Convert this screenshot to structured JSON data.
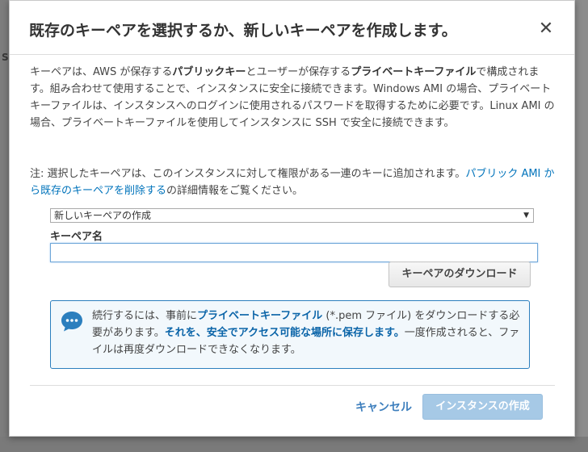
{
  "modal": {
    "title": "既存のキーペアを選択するか、新しいキーペアを作成します。",
    "close_symbol": "✕",
    "description": {
      "p1": "キーペアは、AWS が保存する",
      "b1": "パブリックキー",
      "p2": "とユーザーが保存する",
      "b2": "プライベートキーファイル",
      "p3": "で構成されます。組み合わせて使用することで、インスタンスに安全に接続できます。Windows AMI の場合、プライベートキーファイルは、インスタンスへのログインに使用されるパスワードを取得するために必要です。Linux AMI の場合、プライベートキーファイルを使用してインスタンスに SSH で安全に接続できます。"
    },
    "note": {
      "prefix": "注: 選択したキーペアは、このインスタンスに対して権限がある一連のキーに追加されます。",
      "link": "パブリック AMI から既存のキーペアを削除する",
      "suffix": "の詳細情報をご覧ください。"
    },
    "select": {
      "value": "新しいキーペアの作成"
    },
    "key_name": {
      "label": "キーペア名",
      "value": ""
    },
    "download_label": "キーペアのダウンロード",
    "info": {
      "t1": "続行するには、事前に",
      "b1": "プライベートキーファイル",
      "t2": " (*.pem ファイル) をダウンロードする必要があります。",
      "b2": "それを、安全でアクセス可能な場所に保存します。",
      "t3": "一度作成されると、ファイルは再度ダウンロードできなくなります。"
    },
    "cancel_label": "キャンセル",
    "launch_label": "インスタンスの作成"
  },
  "colors": {
    "link": "#0073bb",
    "info_border": "#2c7fbe",
    "launch_disabled": "#a6c9e6"
  },
  "icons": {
    "info": "chat-bubble-icon",
    "close": "close-icon",
    "dropdown": "chevron-down-icon"
  }
}
